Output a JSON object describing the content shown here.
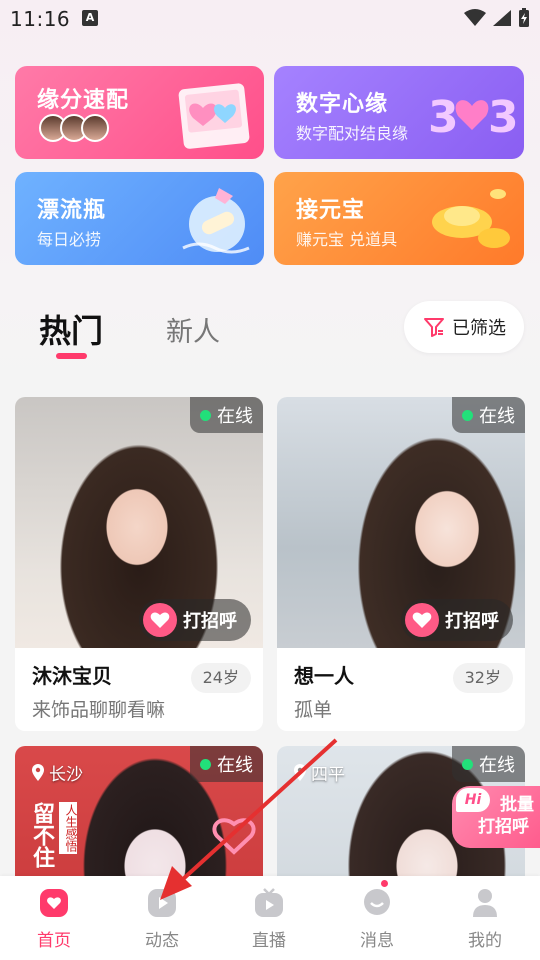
{
  "status_bar": {
    "time": "11:16",
    "a_icon": "A"
  },
  "feature_cards": [
    {
      "title": "缘分速配",
      "subtitle": "",
      "icon": "hearts-photo-icon"
    },
    {
      "title": "数字心缘",
      "subtitle": "数字配对结良缘",
      "icon": "number-heart-icon"
    },
    {
      "title": "漂流瓶",
      "subtitle": "每日必捞",
      "icon": "bottle-icon"
    },
    {
      "title": "接元宝",
      "subtitle": "赚元宝 兑道具",
      "icon": "gold-ingot-icon"
    }
  ],
  "tabs": {
    "hot": "热门",
    "new": "新人"
  },
  "filter": {
    "label": "已筛选"
  },
  "profiles": [
    {
      "name": "沐沐宝贝",
      "age": "24岁",
      "desc": "来饰品聊聊看嘛",
      "online": "在线",
      "greet": "打招呼",
      "location": ""
    },
    {
      "name": "想一人",
      "age": "32岁",
      "desc": "孤单",
      "online": "在线",
      "greet": "打招呼",
      "location": ""
    },
    {
      "name": "",
      "age": "",
      "desc": "",
      "online": "在线",
      "greet": "",
      "location": "长沙"
    },
    {
      "name": "",
      "age": "",
      "desc": "",
      "online": "在线",
      "greet": "",
      "location": "四平"
    }
  ],
  "photo3_text": {
    "big": "留不住",
    "small": "人生感悟"
  },
  "batch_greet": {
    "hi": "Hi",
    "label_line1": "批量",
    "label_line2": "打招呼"
  },
  "bottom_nav": [
    {
      "label": "首页",
      "icon": "home-icon",
      "active": true
    },
    {
      "label": "动态",
      "icon": "play-icon",
      "active": false
    },
    {
      "label": "直播",
      "icon": "tv-icon",
      "active": false
    },
    {
      "label": "消息",
      "icon": "chat-icon",
      "active": false
    },
    {
      "label": "我的",
      "icon": "person-icon",
      "active": false
    }
  ],
  "colors": {
    "accent": "#ff3a6b",
    "online": "#22e07a"
  }
}
